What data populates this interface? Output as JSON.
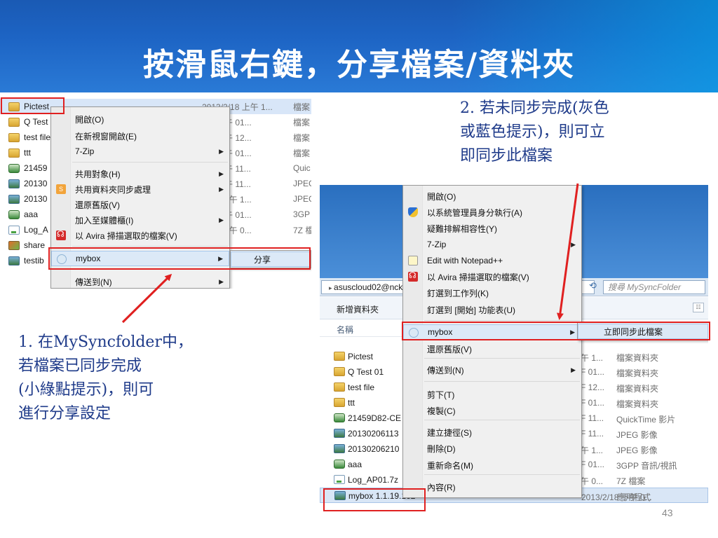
{
  "slide": {
    "title": "按滑鼠右鍵，分享檔案/資料夾",
    "page_number": "43",
    "header_color": "#1d64c4"
  },
  "callouts": {
    "step1": [
      "1. 在MySyncfolder中，",
      "若檔案已同步完成",
      "(小綠點提示)，則可",
      "進行分享設定"
    ],
    "step2": [
      "2. 若未同步完成(灰色",
      "或藍色提示)，則可立",
      "即同步此檔案"
    ]
  },
  "left_screenshot": {
    "files": [
      {
        "name": "Pictest",
        "date": "2013/2/18 上午 1...",
        "type": "檔案",
        "icon": "folder-icon"
      },
      {
        "name": "Q Test",
        "date": "3/4 下午 01...",
        "type": "檔案",
        "icon": "folder-icon"
      },
      {
        "name": "test file",
        "date": "3/4 下午 12...",
        "type": "檔案",
        "icon": "folder-icon"
      },
      {
        "name": "ttt",
        "date": "3/4 下午 01...",
        "type": "檔案",
        "icon": "folder-icon"
      },
      {
        "name": "21459",
        "date": "2/6 上午 11...",
        "type": "Quic",
        "icon": "media-icon"
      },
      {
        "name": "20130",
        "date": "2/6 上午 11...",
        "type": "JPEG",
        "icon": "image-icon"
      },
      {
        "name": "20130",
        "date": "2/18 上午 1...",
        "type": "JPEG",
        "icon": "image-icon"
      },
      {
        "name": "aaa",
        "date": "3/4 下午 01...",
        "type": "3GP",
        "icon": "media-icon"
      },
      {
        "name": "Log_A",
        "date": "2/26 下午 0...",
        "type": "7Z 檔",
        "icon": "file-icon"
      },
      {
        "name": "share",
        "date": "",
        "type": "",
        "icon": "share-icon"
      },
      {
        "name": "testib",
        "date": "",
        "type": "",
        "icon": "image-icon"
      }
    ],
    "context_menu": {
      "items": [
        {
          "label": "開啟(O)",
          "icon": "",
          "arrow": ""
        },
        {
          "label": "在新視窗開啟(E)",
          "icon": "",
          "arrow": ""
        },
        {
          "label": "7-Zip",
          "icon": "",
          "arrow": "▶"
        },
        {
          "label": "共用對象(H)",
          "icon": "",
          "arrow": "▶"
        },
        {
          "label": "共用資料夾同步處理",
          "icon": "sync-icon",
          "arrow": "▶"
        },
        {
          "label": "還原舊版(V)",
          "icon": "",
          "arrow": ""
        },
        {
          "label": "加入至媒體櫃(I)",
          "icon": "",
          "arrow": "▶"
        },
        {
          "label": "以 Avira 掃描選取的檔案(V)",
          "icon": "avira-icon",
          "arrow": ""
        },
        {
          "label": "mybox",
          "icon": "mybox-icon",
          "arrow": "▶"
        },
        {
          "label": "傳送到(N)",
          "icon": "",
          "arrow": "▶"
        }
      ],
      "sync_icon_text": "S",
      "submenu_label": "分享"
    }
  },
  "right_screenshot": {
    "address": "asuscloud02@nck",
    "search_placeholder": "搜尋 MySyncFolder",
    "new_folder": "新增資料夾",
    "column_name": "名稱",
    "files": [
      {
        "name": "Pictest",
        "date": "午 1...",
        "type": "檔案資料夾",
        "icon": "folder-icon"
      },
      {
        "name": "Q Test 01",
        "date": "F 01...",
        "type": "檔案資料夾",
        "icon": "folder-icon"
      },
      {
        "name": "test file",
        "date": "F 12...",
        "type": "檔案資料夾",
        "icon": "folder-icon"
      },
      {
        "name": "ttt",
        "date": "F 01...",
        "type": "檔案資料夾",
        "icon": "folder-icon"
      },
      {
        "name": "21459D82-CE",
        "date": "F 11...",
        "type": "QuickTime 影片",
        "icon": "media-icon"
      },
      {
        "name": "20130206113",
        "date": "F 11...",
        "type": "JPEG 影像",
        "icon": "image-icon"
      },
      {
        "name": "20130206210",
        "date": "午 1...",
        "type": "JPEG 影像",
        "icon": "image-icon"
      },
      {
        "name": "aaa",
        "date": "F 01...",
        "type": "3GPP 音訊/視訊",
        "icon": "media-icon"
      },
      {
        "name": "Log_AP01.7z",
        "date": "午 0...",
        "type": "7Z 檔案",
        "icon": "file-icon"
      },
      {
        "name": "mybox 1.1.19.162",
        "date": "2013/2/18 下午 0...",
        "type": "應用程式",
        "icon": "mybox-app-icon"
      }
    ],
    "context_menu": {
      "items": [
        {
          "label": "開啟(O)",
          "icon": "",
          "arrow": ""
        },
        {
          "label": "以系統管理員身分執行(A)",
          "icon": "shield-icon",
          "arrow": ""
        },
        {
          "label": "疑難排解相容性(Y)",
          "icon": "",
          "arrow": ""
        },
        {
          "label": "7-Zip",
          "icon": "",
          "arrow": "▶"
        },
        {
          "label": "Edit with Notepad++",
          "icon": "notepad-icon",
          "arrow": ""
        },
        {
          "label": "以 Avira 掃描選取的檔案(V)",
          "icon": "avira-icon",
          "arrow": ""
        },
        {
          "label": "釘選到工作列(K)",
          "icon": "",
          "arrow": ""
        },
        {
          "label": "釘選到 [開始] 功能表(U)",
          "icon": "",
          "arrow": ""
        },
        {
          "label": "mybox",
          "icon": "mybox-icon",
          "arrow": "▶"
        },
        {
          "label": "還原舊版(V)",
          "icon": "",
          "arrow": ""
        },
        {
          "label": "傳送到(N)",
          "icon": "",
          "arrow": "▶"
        },
        {
          "label": "剪下(T)",
          "icon": "",
          "arrow": ""
        },
        {
          "label": "複製(C)",
          "icon": "",
          "arrow": ""
        },
        {
          "label": "建立捷徑(S)",
          "icon": "",
          "arrow": ""
        },
        {
          "label": "刪除(D)",
          "icon": "",
          "arrow": ""
        },
        {
          "label": "重新命名(M)",
          "icon": "",
          "arrow": ""
        },
        {
          "label": "內容(R)",
          "icon": "",
          "arrow": ""
        }
      ],
      "submenu_label": "立即同步此檔案"
    }
  },
  "colors": {
    "highlight_red": "#e02020",
    "callout_text": "#1f3b8a"
  }
}
